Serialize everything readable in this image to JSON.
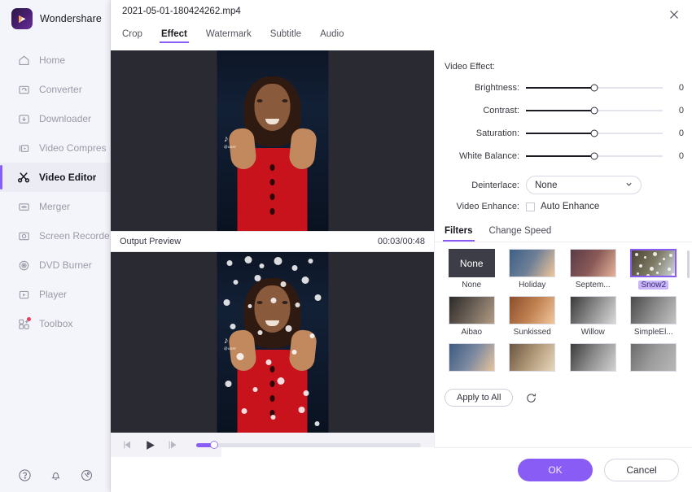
{
  "sidebar": {
    "brand": "Wondershare",
    "items": [
      {
        "label": "Home",
        "icon": "home-icon",
        "active": false
      },
      {
        "label": "Converter",
        "icon": "converter-icon",
        "active": false
      },
      {
        "label": "Downloader",
        "icon": "downloader-icon",
        "active": false
      },
      {
        "label": "Video Compres",
        "icon": "video-compressor-icon",
        "active": false
      },
      {
        "label": "Video Editor",
        "icon": "scissors-icon",
        "active": true
      },
      {
        "label": "Merger",
        "icon": "merger-icon",
        "active": false
      },
      {
        "label": "Screen Recorde",
        "icon": "screen-recorder-icon",
        "active": false
      },
      {
        "label": "DVD Burner",
        "icon": "dvd-burner-icon",
        "active": false
      },
      {
        "label": "Player",
        "icon": "player-icon",
        "active": false
      },
      {
        "label": "Toolbox",
        "icon": "toolbox-icon",
        "active": false
      }
    ],
    "bottom_icons": [
      "help-icon",
      "bell-icon",
      "feedback-icon"
    ]
  },
  "dialog": {
    "title": "2021-05-01-180424262.mp4",
    "close_label": "✕",
    "tabs": [
      {
        "label": "Crop",
        "active": false
      },
      {
        "label": "Effect",
        "active": true
      },
      {
        "label": "Watermark",
        "active": false
      },
      {
        "label": "Subtitle",
        "active": false
      },
      {
        "label": "Audio",
        "active": false
      }
    ]
  },
  "preview": {
    "output_preview_label": "Output Preview",
    "time": "00:03/00:48",
    "watermark": "TikTok",
    "watermark_handle": "@user",
    "controls": {
      "prev_frame": "step-back-icon",
      "play": "play-icon",
      "next_frame": "step-forward-icon"
    },
    "seek_percent": "8"
  },
  "video_effect": {
    "title": "Video Effect:",
    "sliders": [
      {
        "label": "Brightness:",
        "value": "0",
        "percent": 50
      },
      {
        "label": "Contrast:",
        "value": "0",
        "percent": 50
      },
      {
        "label": "Saturation:",
        "value": "0",
        "percent": 50
      },
      {
        "label": "White Balance:",
        "value": "0",
        "percent": 50
      }
    ],
    "deinterlace": {
      "label": "Deinterlace:",
      "value": "None",
      "options": [
        "None"
      ]
    },
    "video_enhance": {
      "label": "Video Enhance:",
      "checkbox_label": "Auto Enhance",
      "checked": false
    }
  },
  "filters_panel": {
    "tabs": [
      {
        "label": "Filters",
        "active": true
      },
      {
        "label": "Change Speed",
        "active": false
      }
    ],
    "items": [
      {
        "name": "None",
        "kind": "none",
        "selected": false
      },
      {
        "name": "Holiday",
        "kind": "image",
        "selected": false,
        "c1": "#3f5f86",
        "c2": "#f0c69a"
      },
      {
        "name": "Septem...",
        "kind": "image",
        "selected": false,
        "c1": "#5a3b46",
        "c2": "#e6b49a"
      },
      {
        "name": "Snow2",
        "kind": "snow",
        "selected": true,
        "c1": "#4a4233",
        "c2": "#cfd6dd"
      },
      {
        "name": "Aibao",
        "kind": "image",
        "selected": false,
        "c1": "#2e2a27",
        "c2": "#b39c84"
      },
      {
        "name": "Sunkissed",
        "kind": "image",
        "selected": false,
        "c1": "#8a4f2c",
        "c2": "#f0c79c"
      },
      {
        "name": "Willow",
        "kind": "image",
        "selected": false,
        "c1": "#3a3a3a",
        "c2": "#d9d9d9"
      },
      {
        "name": "SimpleEl...",
        "kind": "image",
        "selected": false,
        "c1": "#4a4a4a",
        "c2": "#c4c4c4"
      },
      {
        "name": "",
        "kind": "image",
        "selected": false,
        "c1": "#3c5a80",
        "c2": "#e8c49c"
      },
      {
        "name": "",
        "kind": "image",
        "selected": false,
        "c1": "#6a5540",
        "c2": "#e8d8bc"
      },
      {
        "name": "",
        "kind": "image",
        "selected": false,
        "c1": "#3b3b3b",
        "c2": "#d2d2d2"
      },
      {
        "name": "",
        "kind": "image",
        "selected": false,
        "c1": "#6b6b6b",
        "c2": "#b8b8b8"
      }
    ],
    "apply_to_all": "Apply to All",
    "reset_icon": "reset-icon"
  },
  "footer": {
    "ok": "OK",
    "cancel": "Cancel"
  },
  "colors": {
    "accent": "#8a5cf6",
    "sidebar_bg": "#f4f5fa",
    "video_bg": "#2a2a33"
  }
}
